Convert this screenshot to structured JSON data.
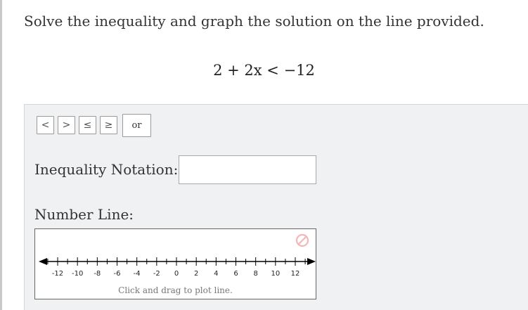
{
  "question": {
    "prompt": "Solve the inequality and graph the solution on the line provided.",
    "equation": "2 + 2x < −12"
  },
  "toolbar": {
    "buttons": [
      {
        "label": "<",
        "name": "less-than-button"
      },
      {
        "label": ">",
        "name": "greater-than-button"
      },
      {
        "label": "≤",
        "name": "less-than-or-equal-button"
      },
      {
        "label": "≥",
        "name": "greater-than-or-equal-button"
      }
    ],
    "or_label": "or"
  },
  "inequality_notation": {
    "label": "Inequality Notation:",
    "value": "",
    "placeholder": ""
  },
  "number_line": {
    "label": "Number Line:",
    "hint": "Click and drag to plot line.",
    "min": -13,
    "max": 13,
    "tick_labels": [
      -12,
      -10,
      -8,
      -6,
      -4,
      -2,
      0,
      2,
      4,
      6,
      8,
      10,
      12
    ],
    "reset_icon": "no-symbol-icon",
    "reset_color": "#f2b8b8"
  }
}
